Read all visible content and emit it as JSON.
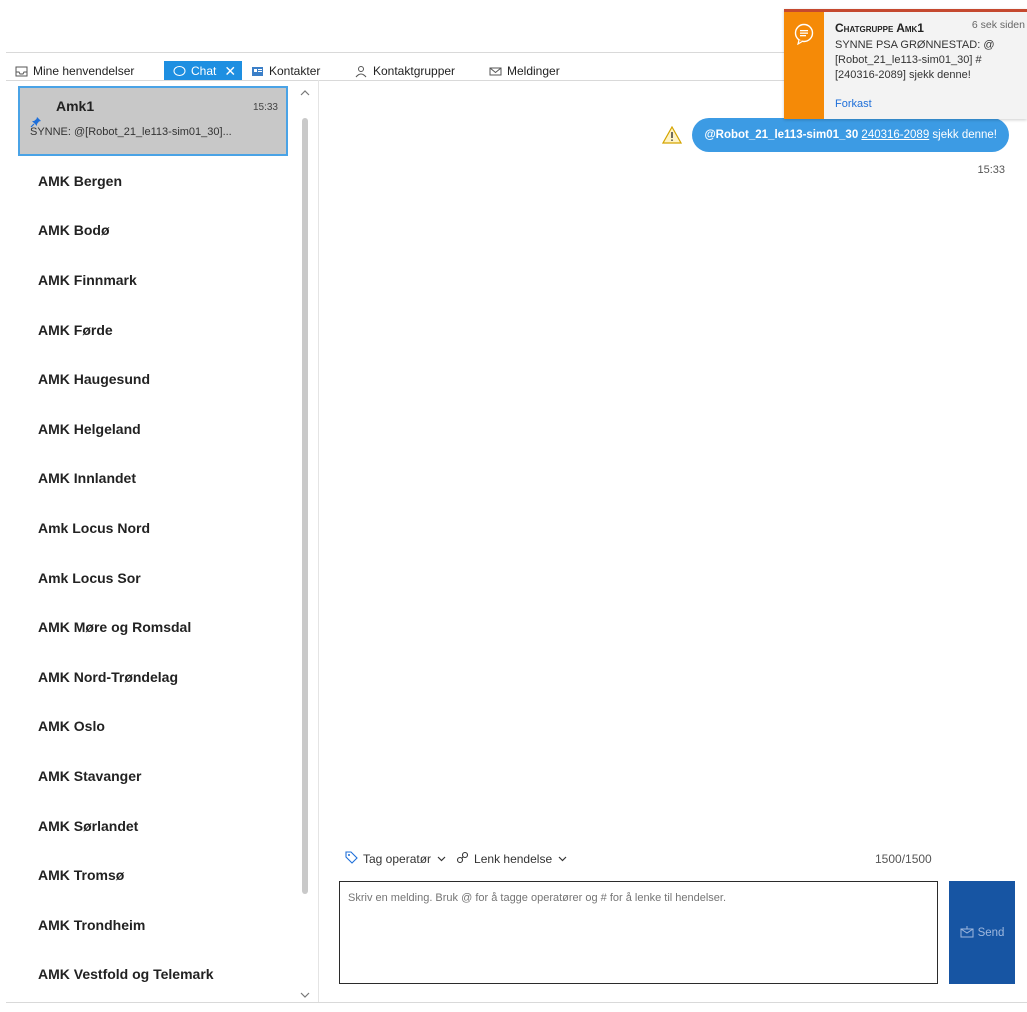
{
  "tabs": [
    {
      "label": "Mine henvendelser",
      "icon": "inbox-icon"
    },
    {
      "label": "Chat",
      "icon": "chat-icon",
      "active": true
    },
    {
      "label": "Kontakter",
      "icon": "contact-card-icon"
    },
    {
      "label": "Kontaktgrupper",
      "icon": "group-icon"
    },
    {
      "label": "Meldinger",
      "icon": "mail-icon"
    }
  ],
  "chatlist": {
    "selected": {
      "name": "Amk1",
      "time": "15:33",
      "preview": "SYNNE: @[Robot_21_le113-sim01_30]..."
    },
    "items": [
      "AMK Bergen",
      "AMK Bodø",
      "AMK Finnmark",
      "AMK Førde",
      "AMK Haugesund",
      "AMK Helgeland",
      "AMK Innlandet",
      "Amk Locus Nord",
      "Amk Locus Sor",
      "AMK Møre og Romsdal",
      "AMK Nord-Trøndelag",
      "AMK Oslo",
      "AMK Stavanger",
      "AMK Sørlandet",
      "AMK Tromsø",
      "AMK Trondheim",
      "AMK Vestfold og Telemark"
    ]
  },
  "conversation": {
    "message": {
      "mention": "@Robot_21_le113-sim01_30",
      "incident_link": "240316-2089",
      "text": "sjekk denne!",
      "time": "15:33"
    }
  },
  "composer": {
    "tag_operator_label": "Tag operatør",
    "link_incident_label": "Lenk hendelse",
    "counter": "1500/1500",
    "placeholder": "Skriv en melding. Bruk @ for å tagge operatører og # for å lenke til hendelser.",
    "send_label": "Send"
  },
  "notification": {
    "title": "Chatgruppe Amk1",
    "age": "6 sek siden",
    "body": "SYNNE PSA GRØNNESTAD: @ [Robot_21_le113-sim01_30] # [240316-2089] sjekk denne!",
    "dismiss_label": "Forkast"
  },
  "colors": {
    "accent": "#1e8fe1",
    "bubble": "#3c9be4",
    "send_button": "#1755a3",
    "toast_bar": "#f58a07",
    "selected_item": "#c8c8c8"
  }
}
